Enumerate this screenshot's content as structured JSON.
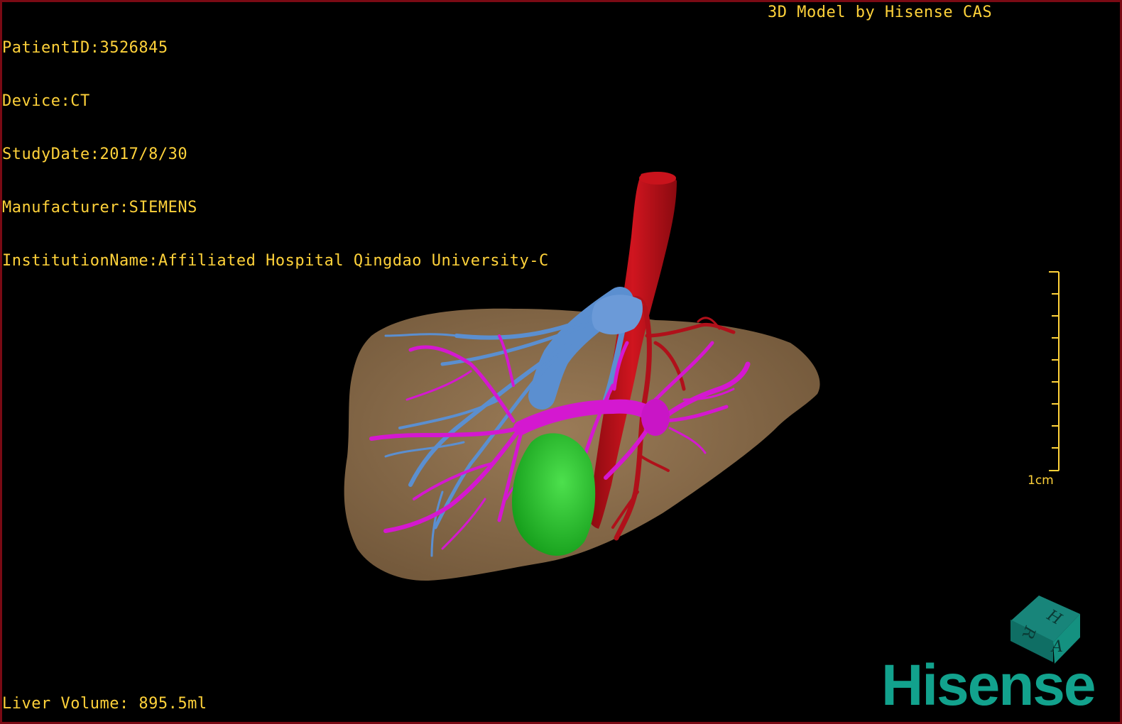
{
  "study": {
    "patient_id": "PatientID:3526845",
    "device": "Device:CT",
    "study_date": "StudyDate:2017/8/30",
    "manufacturer": "Manufacturer:SIEMENS",
    "institution": "InstitutionName:Affiliated Hospital Qingdao University-C"
  },
  "credit": "3D Model by Hisense CAS",
  "liver_volume": "Liver Volume: 895.5ml",
  "scale_bar": {
    "label": "1cm"
  },
  "orientation_cube": {
    "faces": [
      "H",
      "R",
      "A"
    ]
  },
  "logo": {
    "text": "Hisense",
    "color": "#12a28d"
  },
  "colors": {
    "text": "#ffd23a",
    "border": "#7a0a14",
    "liver": "#8c6e4c",
    "aorta": "#b5101a",
    "portal_vein": "#d418d0",
    "hepatic_vein": "#5b8fd0",
    "tumor": "#22c22a"
  }
}
